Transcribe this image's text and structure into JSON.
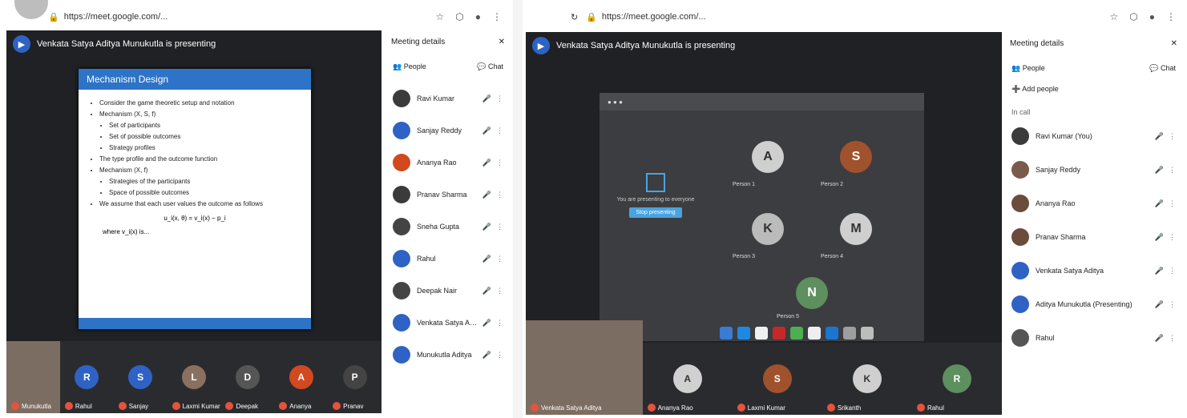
{
  "left": {
    "url": "https://meet.google.com/...",
    "presenter": "Venkata Satya Aditya Munukutla is presenting",
    "slide": {
      "title": "Mechanism Design",
      "lines": [
        "Consider the game theoretic setup and notation",
        "Mechanism (X, S, f)",
        "Set of participants",
        "Set of possible outcomes",
        "Strategy profiles",
        "The type profile and the outcome function",
        "Mechanism (X, f)",
        "Strategies of the participants",
        "Space of possible outcomes",
        "We assume that each user values the outcome as follows"
      ],
      "equation": "u_i(x, θ) = v_i(x) − p_i",
      "note": "where v_i(x) is..."
    },
    "panel": {
      "title": "Meeting details",
      "tab_people": "People",
      "tab_chat": "Chat",
      "participants": [
        {
          "name": "Ravi Kumar",
          "color": "#3b3b3b"
        },
        {
          "name": "Sanjay Reddy",
          "color": "#2f62c5"
        },
        {
          "name": "Ananya Rao",
          "color": "#d2491f"
        },
        {
          "name": "Pranav Sharma",
          "color": "#3b3b3b"
        },
        {
          "name": "Sneha Gupta",
          "color": "#444444"
        },
        {
          "name": "Rahul",
          "color": "#2f62c5"
        },
        {
          "name": "Deepak Nair",
          "color": "#444444"
        },
        {
          "name": "Venkata Satya Aditya",
          "color": "#2f62c5"
        },
        {
          "name": "Munukutla Aditya",
          "color": "#2f62c5"
        }
      ]
    },
    "tiles": [
      {
        "name": "Munukutla",
        "initial": "",
        "color": "#7c6d62"
      },
      {
        "name": "Rahul",
        "initial": "R",
        "color": "#2f62c5"
      },
      {
        "name": "Sanjay",
        "initial": "S",
        "color": "#2f62c5"
      },
      {
        "name": "Laxmi Kumar",
        "initial": "L",
        "color": "#8a7060"
      },
      {
        "name": "Deepak",
        "initial": "D",
        "color": "#555555"
      },
      {
        "name": "Ananya",
        "initial": "A",
        "color": "#d2491f"
      },
      {
        "name": "Pranav",
        "initial": "P",
        "color": "#444444"
      }
    ]
  },
  "right": {
    "url": "https://meet.google.com/...",
    "presenter": "Venkata Satya Aditya Munukutla is presenting",
    "share_text": "You are presenting to everyone",
    "share_button": "Stop presenting",
    "gallery": [
      {
        "name": "Person 1",
        "initial": "A",
        "color": "#cfcfcf"
      },
      {
        "name": "Person 2",
        "initial": "S",
        "color": "#a0522d"
      },
      {
        "name": "Person 3",
        "initial": "K",
        "color": "#bbbbbb"
      },
      {
        "name": "Person 4",
        "initial": "M",
        "color": "#cfcfcf"
      },
      {
        "name": "Person 5",
        "initial": "N",
        "color": "#5e8f5e"
      }
    ],
    "tiles": [
      {
        "name": "Venkata Satya Aditya",
        "initial": "",
        "color": "#7c6d62"
      },
      {
        "name": "Ananya Rao",
        "initial": "A",
        "color": "#d0d0d0"
      },
      {
        "name": "Laxmi Kumar",
        "initial": "S",
        "color": "#a0522d"
      },
      {
        "name": "Srikanth",
        "initial": "K",
        "color": "#cfcfcf"
      },
      {
        "name": "Rahul",
        "initial": "R",
        "color": "#5e8f5e"
      }
    ],
    "panel": {
      "title": "Meeting details",
      "tab_people": "People",
      "tab_chat": "Chat",
      "add_people": "Add people",
      "section": "In call",
      "participants": [
        {
          "name": "Ravi Kumar (You)",
          "color": "#3b3b3b"
        },
        {
          "name": "Sanjay Reddy",
          "color": "#7a5a4a"
        },
        {
          "name": "Ananya Rao",
          "color": "#6b4b3b"
        },
        {
          "name": "Pranav Sharma",
          "color": "#6b4b3b"
        },
        {
          "name": "Venkata Satya Aditya",
          "color": "#2f62c5"
        },
        {
          "name": "Aditya Munukutla (Presenting)",
          "color": "#2f62c5"
        },
        {
          "name": "Rahul",
          "color": "#555555"
        }
      ]
    }
  }
}
